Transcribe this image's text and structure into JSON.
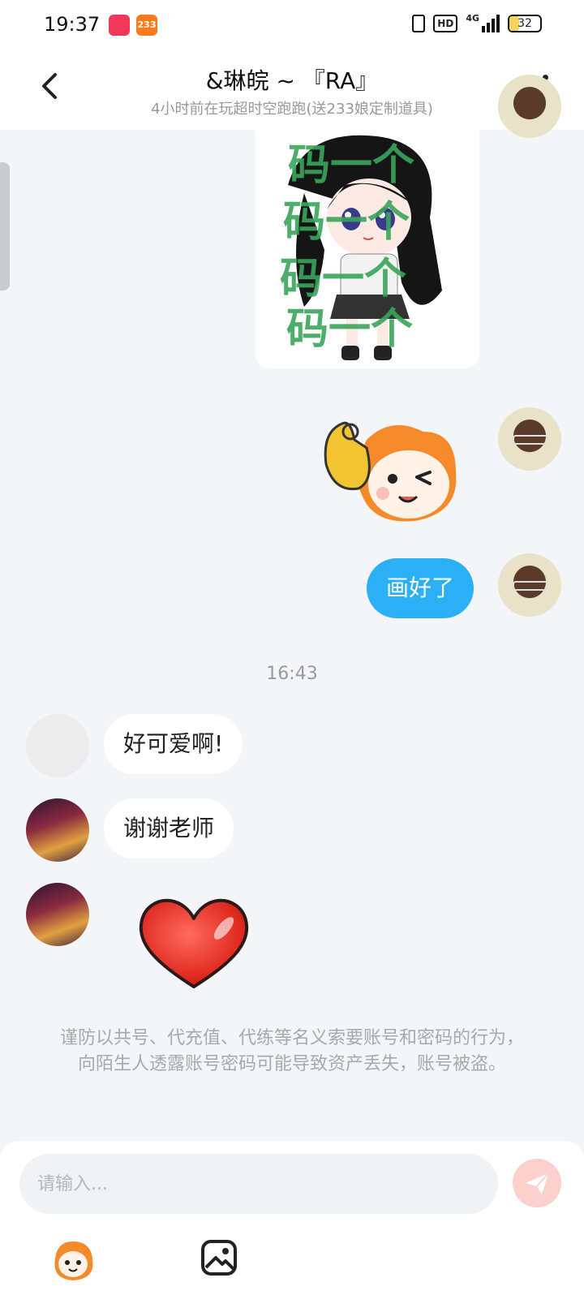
{
  "status_bar": {
    "time": "19:37",
    "app_badge_2": "233",
    "network": "4G",
    "hd": "HD",
    "battery": "32",
    "battery_level_percent": 32
  },
  "header": {
    "title": "&琳皖 ~ 『RA』",
    "subtitle": "4小时前在玩超时空跑跑(送233娘定制道具)"
  },
  "watermark": {
    "text": "码一个"
  },
  "messages": {
    "m3_text": "画好了",
    "time_separator": "16:43",
    "m4_text": "好可爱啊!",
    "m5_text": "谢谢老师"
  },
  "warning": "谨防以共号、代充值、代练等名义索要账号和密码的行为，向陌生人透露账号密码可能导致资产丢失，账号被盗。",
  "input": {
    "placeholder": "请输入..."
  },
  "colors": {
    "outgoing_bubble": "#2cb0f5",
    "send_button_disabled": "#fcd1cd",
    "background": "#f3f5f8"
  }
}
